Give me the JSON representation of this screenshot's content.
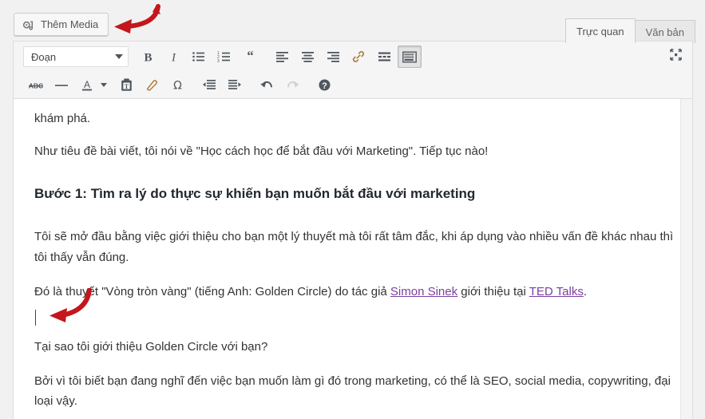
{
  "toolbar_top": {
    "add_media_label": "Thêm Media",
    "add_media_icon": "media-icon",
    "tabs": [
      {
        "label": "Trực quan",
        "active": true
      },
      {
        "label": "Văn bản",
        "active": false
      }
    ]
  },
  "editor_toolbar": {
    "format_select": {
      "value": "Đoạn",
      "caret_icon": "chevron-down-icon"
    },
    "row1": [
      {
        "name": "bold-button",
        "icon": "bold-icon",
        "active": false
      },
      {
        "name": "italic-button",
        "icon": "italic-icon",
        "active": false
      },
      {
        "name": "bullet-list-button",
        "icon": "unordered-list-icon",
        "active": false
      },
      {
        "name": "numbered-list-button",
        "icon": "ordered-list-icon",
        "active": false
      },
      {
        "name": "blockquote-button",
        "icon": "quote-icon",
        "active": false
      },
      {
        "name": "align-left-button",
        "icon": "align-left-icon",
        "active": false
      },
      {
        "name": "align-center-button",
        "icon": "align-center-icon",
        "active": false
      },
      {
        "name": "align-right-button",
        "icon": "align-right-icon",
        "active": false
      },
      {
        "name": "insert-link-button",
        "icon": "link-icon",
        "active": false
      },
      {
        "name": "read-more-button",
        "icon": "read-more-icon",
        "active": false
      },
      {
        "name": "toolbar-toggle-button",
        "icon": "kitchen-sink-icon",
        "active": true
      }
    ],
    "row2": [
      {
        "name": "strikethrough-button",
        "icon": "strikethrough-icon",
        "active": false
      },
      {
        "name": "horizontal-rule-button",
        "icon": "horizontal-rule-icon",
        "active": false
      },
      {
        "name": "text-color-button",
        "icon": "text-color-icon",
        "active": false
      },
      {
        "name": "paste-as-text-button",
        "icon": "paste-text-icon",
        "active": false
      },
      {
        "name": "clear-formatting-button",
        "icon": "eraser-icon",
        "active": false
      },
      {
        "name": "special-character-button",
        "icon": "omega-icon",
        "active": false
      },
      {
        "name": "outdent-button",
        "icon": "outdent-icon",
        "active": false
      },
      {
        "name": "indent-button",
        "icon": "indent-icon",
        "active": false
      },
      {
        "name": "undo-button",
        "icon": "undo-icon",
        "active": false
      },
      {
        "name": "redo-button",
        "icon": "redo-icon",
        "disabled": true
      },
      {
        "name": "keyboard-shortcuts-button",
        "icon": "help-icon",
        "active": false
      }
    ],
    "fullscreen_icon": "fullscreen-icon"
  },
  "content": {
    "para_1": "khám phá.",
    "para_2": "Như tiêu đề bài viết, tôi nói về \"Học cách học để bắt đầu với Marketing\". Tiếp tục nào!",
    "heading_step_1": "Bước 1: Tìm ra lý do thực sự khiến bạn muốn bắt đầu với marketing",
    "para_3": "Tôi sẽ mở đầu bằng việc giới thiệu cho bạn một lý thuyết mà tôi rất tâm đắc, khi áp dụng vào nhiều vấn đề khác nhau thì tôi thấy vẫn đúng.",
    "para_4_before_link1": "Đó là thuyết \"Vòng tròn vàng\" (tiếng Anh: Golden Circle) do tác giả ",
    "link_1": "Simon Sinek",
    "para_4_between_links": " giới thiệu tại ",
    "link_2": "TED Talks",
    "para_4_after_link2": ".",
    "para_5": "Tại sao tôi giới thiệu Golden Circle với bạn?",
    "para_6": "Bởi vì tôi biết bạn đang nghĩ đến việc bạn muốn làm gì đó trong marketing, có thể là SEO, social media, copywriting, đại loại vậy."
  },
  "annotations": {
    "arrow_top_name": "red-arrow-pointing-to-add-media",
    "arrow_mid_name": "red-arrow-pointing-to-text-cursor",
    "arrow_color": "#c4161c"
  },
  "colors": {
    "link": "#7b3fa0",
    "page_bg": "#f1f1f1",
    "toolbar_bg": "#f5f5f5",
    "icon": "#50575e",
    "text": "#333333"
  }
}
